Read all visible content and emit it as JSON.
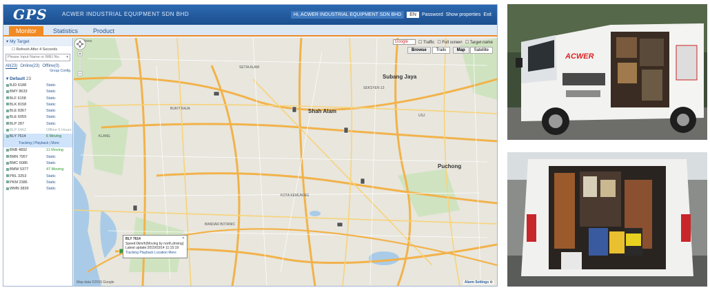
{
  "app": {
    "logo": "GPS",
    "company": "ACWER INDUSTRIAL EQUIPMENT SDN BHD",
    "user": "Hi, ACWER INDUSTRIAL EQUIPMENT SDN BHD",
    "language": "EN",
    "links": [
      "Password",
      "Show properties",
      "Exit"
    ],
    "accent": "#f08a24",
    "brand": "#1e5a9c"
  },
  "nav": {
    "tabs": [
      "Monitor",
      "Statistics",
      "Product"
    ],
    "active": "Monitor"
  },
  "left_panel": {
    "header": "My Target",
    "refresh": "Refresh After 4 Seconds",
    "search_placeholder": "Please Input Name or IMEI No.",
    "tabs": [
      "All(23)",
      "Online(23)",
      "Offline(0)"
    ],
    "sub_links": "Group  Config",
    "group": "Default",
    "group_count": "23",
    "vehicles": [
      {
        "plate": "BJD 6188",
        "status": "Static",
        "kind": "normal"
      },
      {
        "plate": "BMY 8633",
        "status": "Static",
        "kind": "normal"
      },
      {
        "plate": "BLF 6158",
        "status": "Static",
        "kind": "normal"
      },
      {
        "plate": "BLK 8158",
        "status": "Static",
        "kind": "normal"
      },
      {
        "plate": "BLE 8367",
        "status": "Static",
        "kind": "normal"
      },
      {
        "plate": "BLE 6059",
        "status": "Static",
        "kind": "normal"
      },
      {
        "plate": "BLP 287",
        "status": "Static",
        "kind": "normal"
      },
      {
        "plate": "BLP 6462",
        "status": "Offline 6 Hours",
        "kind": "offline"
      },
      {
        "plate": "BLY 7614",
        "status": "6 Moving",
        "kind": "selected",
        "sub": "Tracking | Playback | More"
      },
      {
        "plate": "BNB 4892",
        "status": "11 Moving",
        "kind": "green"
      },
      {
        "plate": "BMN 7957",
        "status": "Static",
        "kind": "normal"
      },
      {
        "plate": "BMC 6086",
        "status": "Static",
        "kind": "normal"
      },
      {
        "plate": "BMW 5377",
        "status": "47 Moving",
        "kind": "green"
      },
      {
        "plate": "PRL 3253",
        "status": "Static",
        "kind": "normal"
      },
      {
        "plate": "PKM 2386",
        "status": "Static",
        "kind": "normal"
      },
      {
        "plate": "WMN 3839",
        "status": "Static",
        "kind": "normal"
      }
    ]
  },
  "map": {
    "title": "Positions",
    "provider": "Google",
    "options": [
      "Traffic",
      "Full screen",
      "Target name"
    ],
    "view_buttons": [
      "Browse",
      "Trails"
    ],
    "type_buttons": [
      "Map",
      "Satellite"
    ],
    "labels": {
      "shah_alam": "Shah Alam",
      "subang": "Subang Jaya",
      "puchong": "Puchong",
      "klang": "KLANG",
      "kota": "KOTA KEMUNING",
      "bandar": "BANDAR BOTANIC",
      "bukit": "BUKIT RAJA",
      "setia": "SETIA ALAM",
      "usj": "USJ",
      "seksyen": "SEKSYEN 13"
    },
    "info_window": {
      "title": "BLY 7614",
      "line1": "Speed:0km/h(Moving by north,driving)",
      "line2": "Latest update:2015/03/14 11:15:19",
      "links": "Tracking  Playback  Location  More"
    },
    "footer_left": "Map data ©2015 Google",
    "footer_right": "Alarm Settings"
  },
  "photos": {
    "van_brand": "ACWER"
  }
}
